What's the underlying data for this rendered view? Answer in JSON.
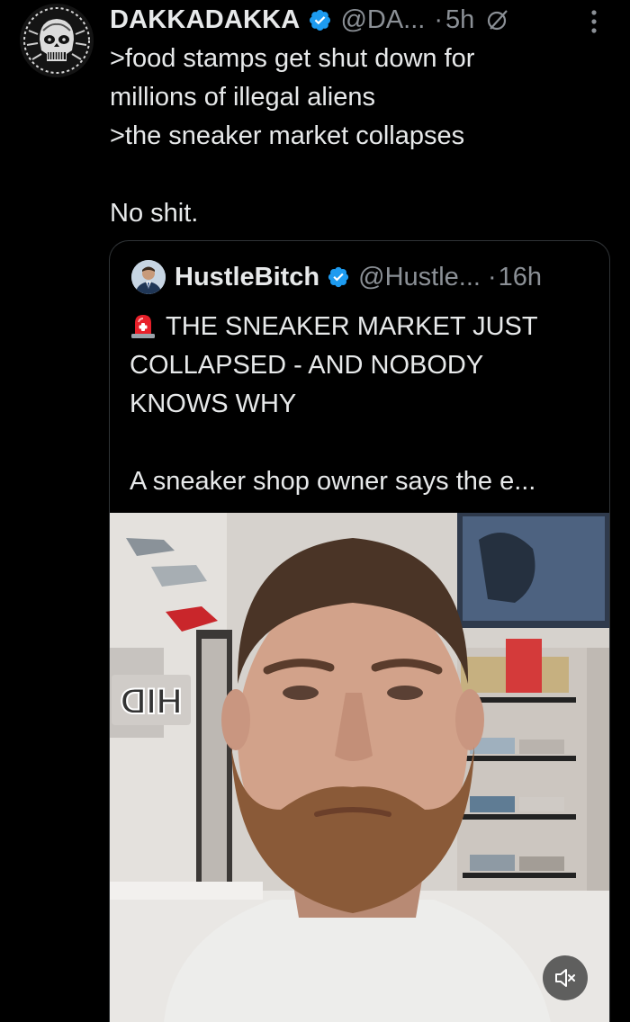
{
  "post": {
    "author": {
      "display_name": "DAKKADAKKA",
      "handle": "@DA...",
      "verified": true,
      "avatar_icon": "skull-avatar-icon"
    },
    "separator": "·",
    "time": "5h",
    "lines": [
      ">food stamps get shut down for",
      "millions of illegal aliens",
      ">the sneaker market collapses",
      "",
      "No shit."
    ],
    "icons": {
      "verified": "verified-badge-icon",
      "grok": "grok-icon",
      "more": "more-options-icon"
    },
    "accent_color": "#1d9bf0"
  },
  "quoted_post": {
    "author": {
      "display_name": "HustleBitch",
      "handle": "@Hustle...",
      "verified": true
    },
    "separator": "·",
    "time": "16h",
    "emoji": "rotating-light-icon",
    "lines": [
      "THE SNEAKER MARKET JUST",
      "COLLAPSED - AND NOBODY",
      "KNOWS WHY",
      "",
      "A sneaker shop owner says the e..."
    ],
    "media": {
      "type": "video",
      "wall_sign_text": "HID",
      "mute_icon": "muted-speaker-icon"
    }
  }
}
